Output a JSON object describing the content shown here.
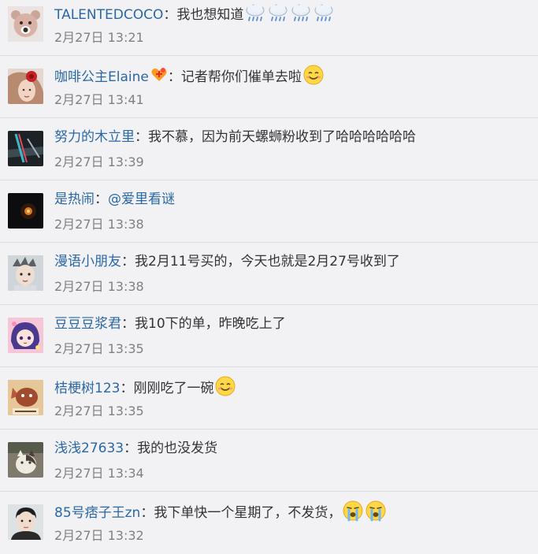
{
  "comments": [
    {
      "user": "TALENTEDCOCO",
      "separator": "：",
      "text": "我也想知道",
      "emoji": [
        "rain-cloud-icon",
        "rain-cloud-icon",
        "rain-cloud-icon",
        "rain-cloud-icon"
      ],
      "time": "2月27日 13:21",
      "avatar": "bear-avatar"
    },
    {
      "user": "咖啡公主Elaine",
      "separator": "：",
      "text": "记者帮你们催单去啦",
      "badge": "love-badge-icon",
      "emoji": [
        "smile-emoji-icon"
      ],
      "time": "2月27日 13:41",
      "avatar": "woman-red-flower-avatar"
    },
    {
      "user": "努力的木立里",
      "separator": "：",
      "text": "我不慕，因为前天螺蛳粉收到了哈哈哈哈哈哈",
      "time": "2月27日 13:39",
      "avatar": "dark-glitch-avatar"
    },
    {
      "user": "是热闹",
      "separator": "：",
      "text": "",
      "mention": "@爱里看谜",
      "time": "2月27日 13:38",
      "avatar": "dark-light-avatar"
    },
    {
      "user": "漫语小朋友",
      "separator": "：",
      "text": "我2月11号买的，今天也就是2月27号收到了",
      "time": "2月27日 13:38",
      "avatar": "child-portrait-avatar"
    },
    {
      "user": "豆豆豆浆君",
      "separator": "：",
      "text": "我10下的单，昨晚吃上了",
      "time": "2月27日 13:35",
      "avatar": "anime-girl-avatar"
    },
    {
      "user": "桔梗树123",
      "separator": "：",
      "text": "刚刚吃了一碗",
      "emoji": [
        "smile-emoji-icon"
      ],
      "time": "2月27日 13:35",
      "avatar": "cartoon-cat-avatar"
    },
    {
      "user": "浅浅27633",
      "separator": "：",
      "text": "我的也没发货",
      "time": "2月27日 13:34",
      "avatar": "cat-photo-avatar"
    },
    {
      "user": "85号痞子王zn",
      "separator": "：",
      "text": "我下单快一个星期了，不发货，",
      "emoji": [
        "crying-emoji-icon",
        "crying-emoji-icon"
      ],
      "time": "2月27日 13:32",
      "avatar": "man-portrait-avatar"
    }
  ],
  "colors": {
    "background": "#f2f2f5",
    "username": "#2a68a5",
    "text": "#333333",
    "time": "#808080",
    "divider": "#dcdcdf"
  }
}
